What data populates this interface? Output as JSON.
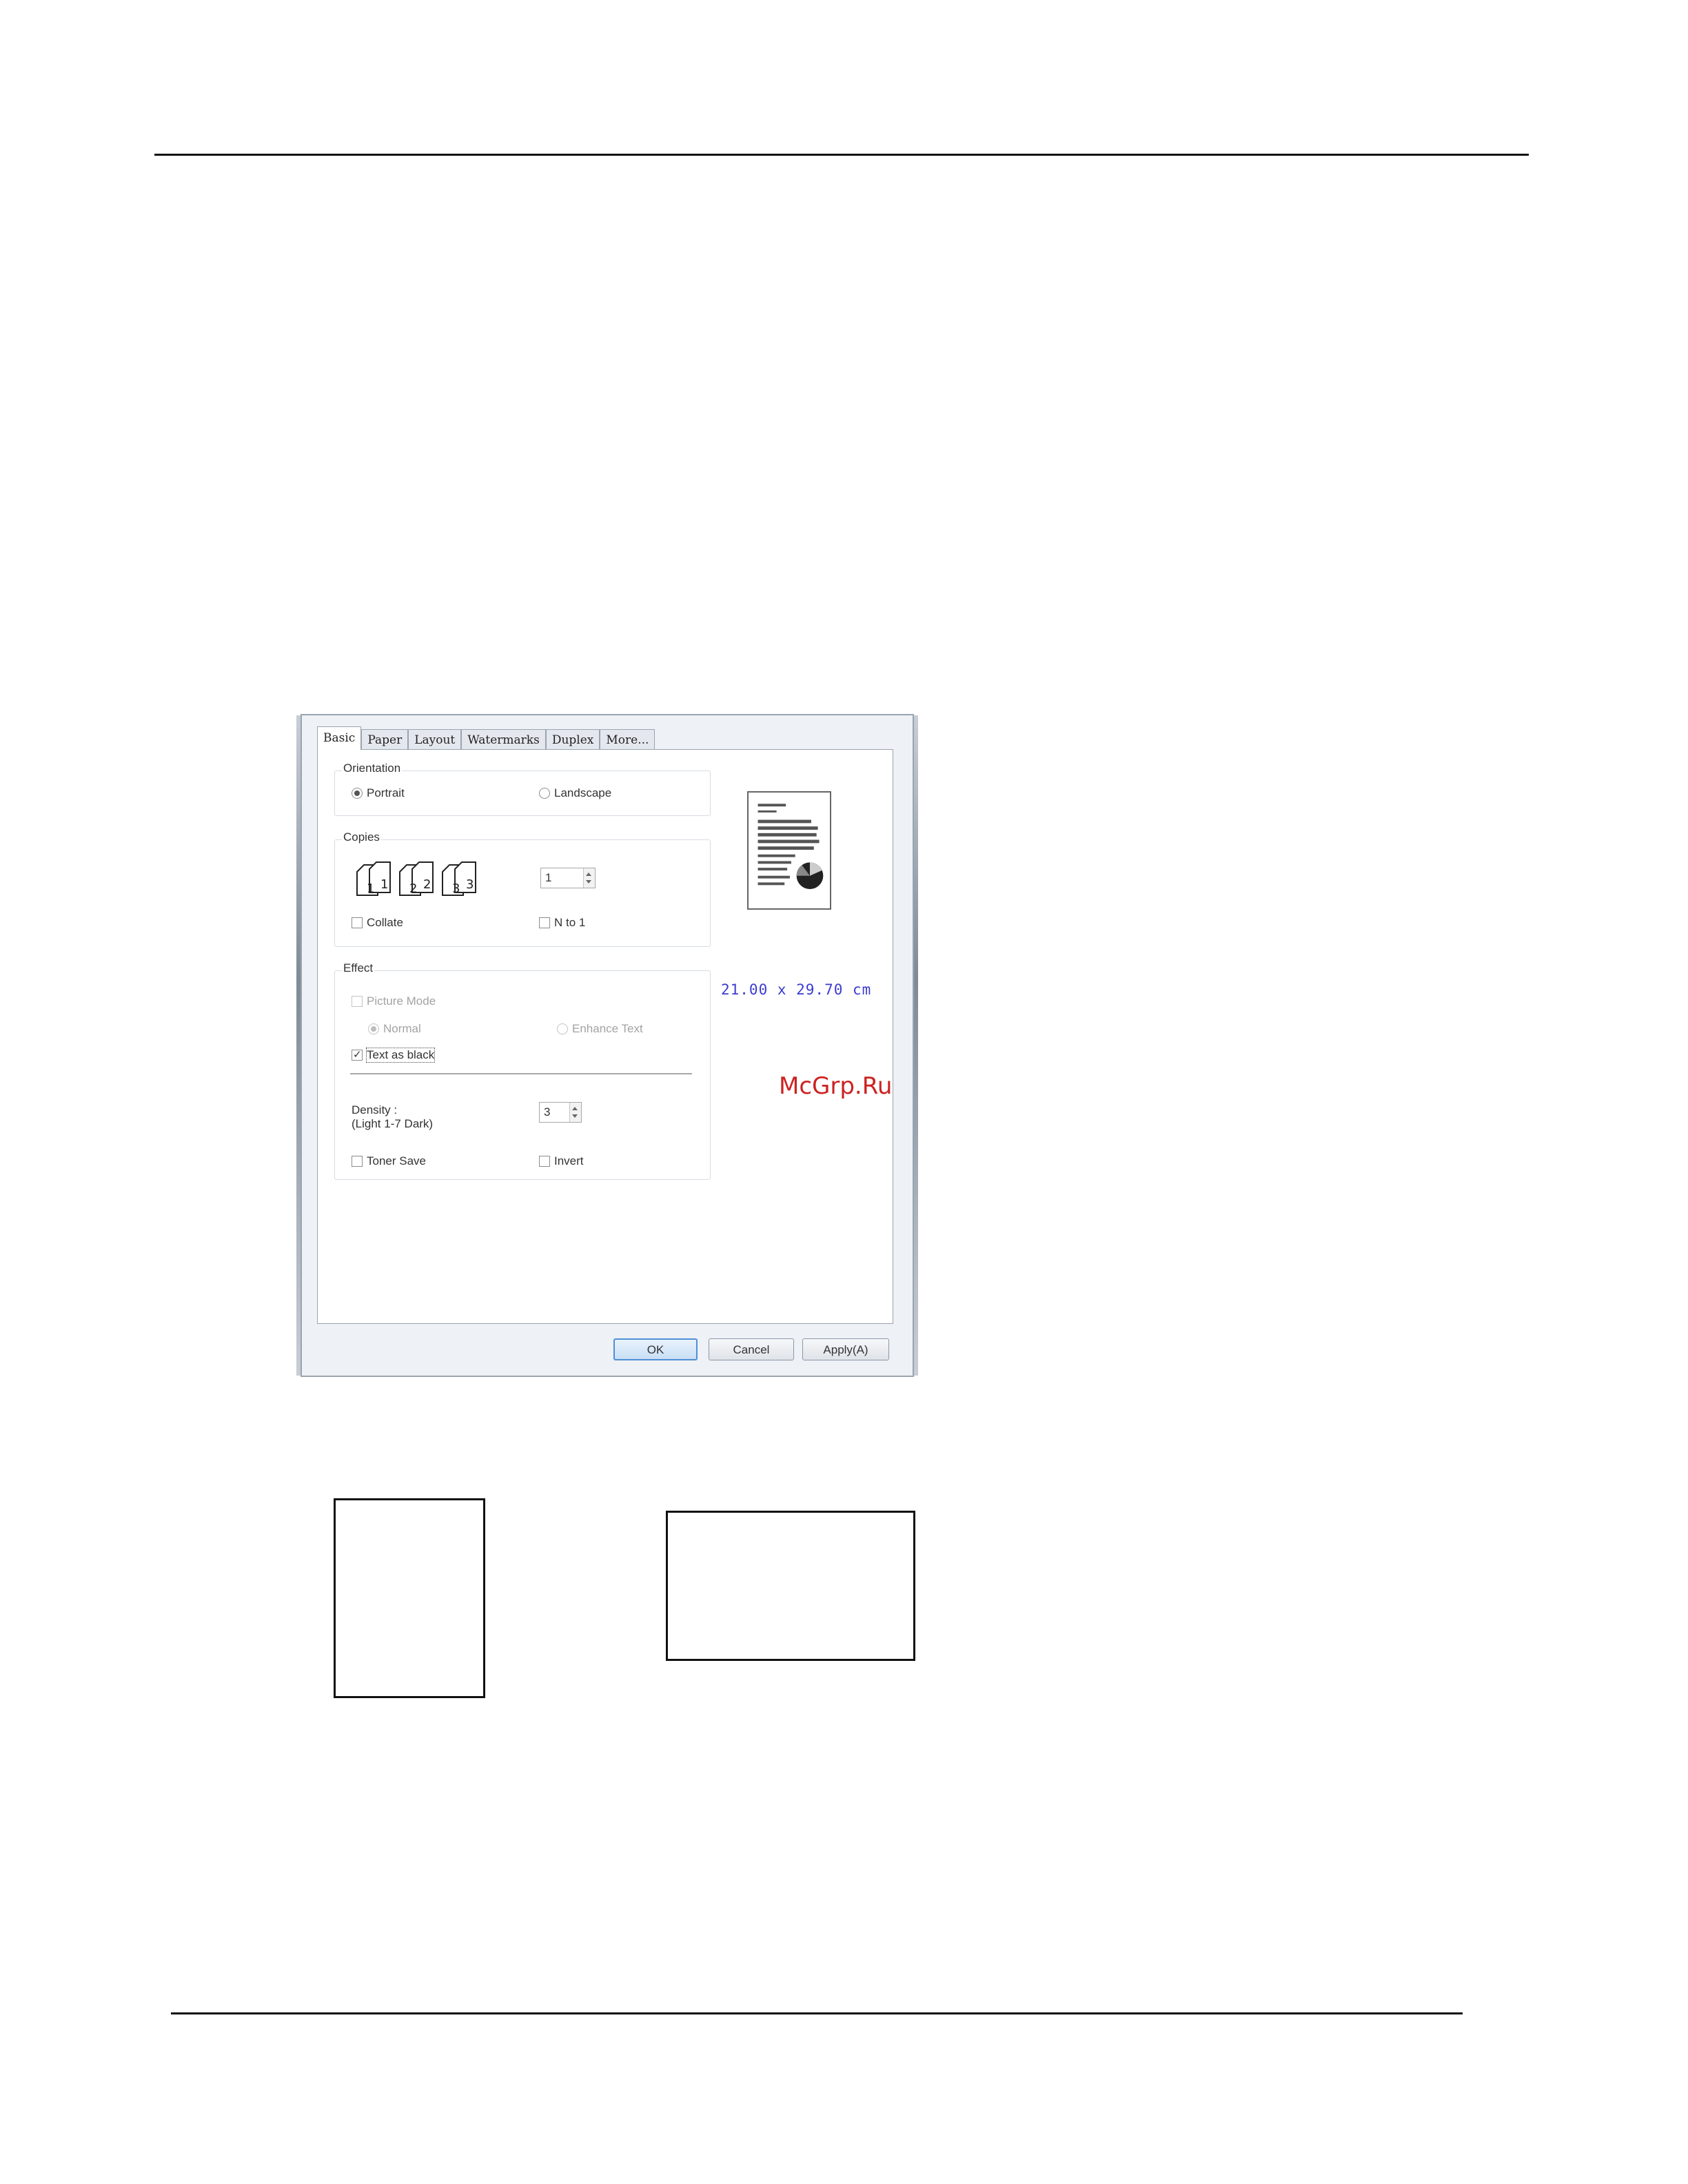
{
  "tabs": [
    {
      "label": "Basic",
      "active": true
    },
    {
      "label": "Paper",
      "active": false
    },
    {
      "label": "Layout",
      "active": false
    },
    {
      "label": "Watermarks",
      "active": false
    },
    {
      "label": "Duplex",
      "active": false
    },
    {
      "label": "More...",
      "active": false
    }
  ],
  "orientation": {
    "title": "Orientation",
    "portrait_label": "Portrait",
    "landscape_label": "Landscape",
    "selected": "Portrait"
  },
  "copies": {
    "title": "Copies",
    "count": "1",
    "collate_label": "Collate",
    "collate_checked": false,
    "n_to_1_label": "N to 1",
    "n_to_1_checked": false
  },
  "effect": {
    "title": "Effect",
    "picture_mode_label": "Picture Mode",
    "picture_mode_checked": false,
    "normal_label": "Normal",
    "enhance_text_label": "Enhance Text",
    "text_as_black_label": "Text as black",
    "text_as_black_checked": true,
    "density_label": "Density :",
    "density_range_label": "(Light 1-7 Dark)",
    "density_value": "3",
    "toner_save_label": "Toner Save",
    "toner_save_checked": false,
    "invert_label": "Invert",
    "invert_checked": false
  },
  "paper_size": "21.00 x 29.70 cm",
  "buttons": {
    "ok": "OK",
    "cancel": "Cancel",
    "apply": "Apply(A)"
  },
  "watermark": "McGrp.Ru",
  "icons": [
    "copies-collate-icon",
    "page-preview-icon",
    "spinner-arrows-icon"
  ]
}
